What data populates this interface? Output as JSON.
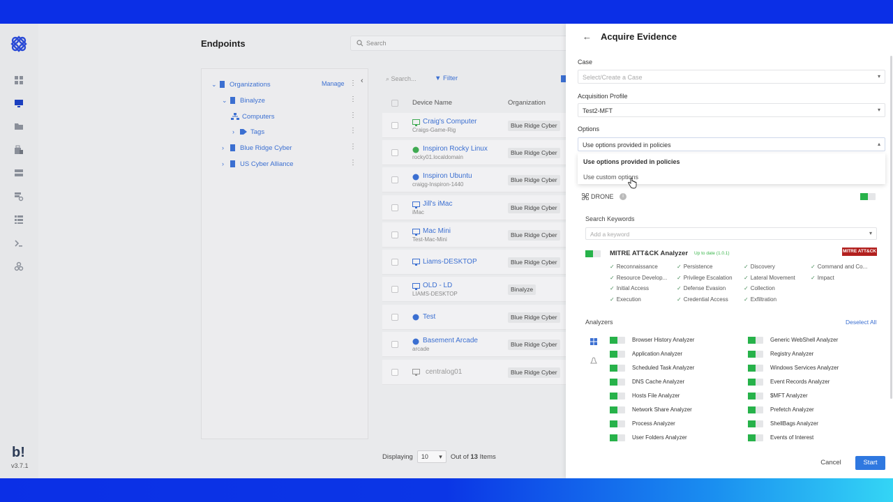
{
  "app": {
    "brand": "b!",
    "version": "v3.7.1"
  },
  "header": {
    "title": "Endpoints",
    "search_placeholder": "Search"
  },
  "tree": {
    "manage_label": "Manage",
    "nodes": [
      {
        "label": "Organizations"
      },
      {
        "label": "Binalyze"
      },
      {
        "label": "Computers"
      },
      {
        "label": "Tags"
      },
      {
        "label": "Blue Ridge Cyber"
      },
      {
        "label": "US Cyber Alliance"
      }
    ]
  },
  "list": {
    "search_placeholder": "Search...",
    "filter_label": "Filter",
    "columns": {
      "device": "Device Name",
      "org": "Organization"
    },
    "rows": [
      {
        "name": "Craig's Computer",
        "sub": "Craigs-Game-Rig",
        "org": "Blue Ridge Cyber"
      },
      {
        "name": "Inspiron Rocky Linux",
        "sub": "rocky01.localdomain",
        "org": "Blue Ridge Cyber"
      },
      {
        "name": "Inspiron Ubuntu",
        "sub": "craigg-Inspiron-1440",
        "org": "Blue Ridge Cyber"
      },
      {
        "name": "Jill's iMac",
        "sub": "iMac",
        "org": "Blue Ridge Cyber"
      },
      {
        "name": "Mac Mini",
        "sub": "Test-Mac-Mini",
        "org": "Blue Ridge Cyber"
      },
      {
        "name": "Liams-DESKTOP",
        "sub": "",
        "org": "Blue Ridge Cyber"
      },
      {
        "name": "OLD - LD",
        "sub": "LIAMS-DESKTOP",
        "org": "Binalyze"
      },
      {
        "name": "Test",
        "sub": "",
        "org": "Blue Ridge Cyber"
      },
      {
        "name": "Basement Arcade",
        "sub": "arcade",
        "org": "Blue Ridge Cyber"
      },
      {
        "name": "centralog01",
        "sub": "",
        "org": "Blue Ridge Cyber"
      }
    ],
    "footer": {
      "displaying": "Displaying",
      "page_size": "10",
      "out_of": "Out of",
      "total": "13",
      "items": "Items"
    }
  },
  "drawer": {
    "title": "Acquire Evidence",
    "case_label": "Case",
    "case_placeholder": "Select/Create a Case",
    "profile_label": "Acquisition Profile",
    "profile_value": "Test2-MFT",
    "options_label": "Options",
    "options_value": "Use options provided in policies",
    "options_menu": [
      "Use options provided in policies",
      "Use custom options"
    ],
    "drone_label": "DRONE",
    "keywords_label": "Search Keywords",
    "keywords_placeholder": "Add a keyword",
    "mitre": {
      "title": "MITRE ATT&CK Analyzer",
      "status": "Up to date (1.0.1)",
      "badge": "MITRE ATT&CK",
      "tactics": [
        "Reconnaissance",
        "Persistence",
        "Discovery",
        "Command and Co...",
        "Resource Develop...",
        "Privilege Escalation",
        "Lateral Movement",
        "Impact",
        "Initial Access",
        "Defense Evasion",
        "Collection",
        "Execution",
        "Credential Access",
        "Exfiltration"
      ]
    },
    "analyzers_label": "Analyzers",
    "deselect_all": "Deselect All",
    "analyzers_left": [
      "Browser History Analyzer",
      "Application Analyzer",
      "Scheduled Task Analyzer",
      "DNS Cache Analyzer",
      "Hosts File Analyzer",
      "Network Share Analyzer",
      "Process Analyzer",
      "User Folders Analyzer"
    ],
    "analyzers_right": [
      "Generic WebShell Analyzer",
      "Registry Analyzer",
      "Windows Services Analyzer",
      "Event Records Analyzer",
      "$MFT Analyzer",
      "Prefetch Analyzer",
      "ShellBags Analyzer",
      "Events of Interest"
    ],
    "cancel": "Cancel",
    "start": "Start"
  },
  "colors": {
    "accent": "#2f78e0",
    "link": "#3b6fd1",
    "toggle_on": "#27b24a",
    "mitre_badge": "#b2201e"
  }
}
